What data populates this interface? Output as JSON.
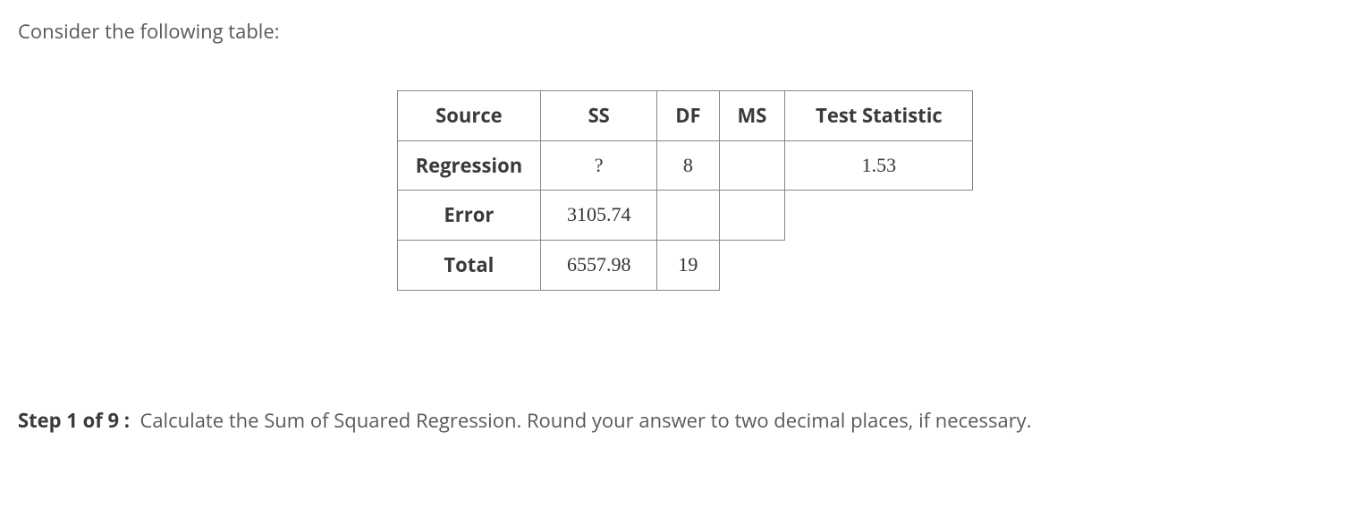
{
  "intro": "Consider the following table:",
  "headers": {
    "source": "Source",
    "ss": "SS",
    "df": "DF",
    "ms": "MS",
    "ts": "Test Statistic"
  },
  "rows": {
    "regression": {
      "label": "Regression",
      "ss": "?",
      "df": "8",
      "ms": "",
      "ts": "1.53"
    },
    "error": {
      "label": "Error",
      "ss": "3105.74",
      "df": "",
      "ms": ""
    },
    "total": {
      "label": "Total",
      "ss": "6557.98",
      "df": "19"
    }
  },
  "step": {
    "label": "Step 1 of 9 :",
    "text": "Calculate the Sum of Squared Regression. Round your answer to two decimal places, if necessary."
  },
  "chart_data": {
    "type": "table",
    "title": "ANOVA Table",
    "columns": [
      "Source",
      "SS",
      "DF",
      "MS",
      "Test Statistic"
    ],
    "rows": [
      [
        "Regression",
        "?",
        8,
        null,
        1.53
      ],
      [
        "Error",
        3105.74,
        null,
        null,
        null
      ],
      [
        "Total",
        6557.98,
        19,
        null,
        null
      ]
    ]
  }
}
